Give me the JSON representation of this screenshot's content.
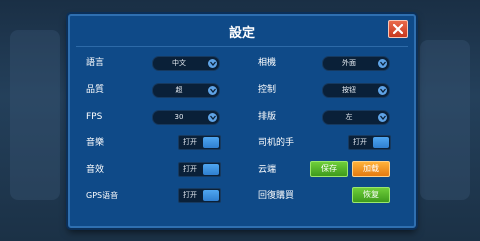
{
  "dialog": {
    "title": "設定",
    "close_icon": "close-icon"
  },
  "left": {
    "language": {
      "label": "語言",
      "value": "中文"
    },
    "quality": {
      "label": "品質",
      "value": "超"
    },
    "fps": {
      "label": "FPS",
      "value": "30"
    },
    "music": {
      "label": "音樂",
      "toggle_label": "打开"
    },
    "sound": {
      "label": "音效",
      "toggle_label": "打开"
    },
    "gps_voice": {
      "label": "GPS语音",
      "toggle_label": "打开"
    }
  },
  "right": {
    "camera": {
      "label": "相機",
      "value": "外面"
    },
    "control": {
      "label": "控制",
      "value": "按钮"
    },
    "layout": {
      "label": "排版",
      "value": "左"
    },
    "driver_hand": {
      "label": "司机的手",
      "toggle_label": "打开"
    },
    "cloud": {
      "label": "云端",
      "save_label": "保存",
      "load_label": "加载"
    },
    "restore_purchase": {
      "label": "回復購買",
      "button_label": "恢复"
    }
  },
  "colors": {
    "panel": "#0f4a88",
    "save_button": "#4caf2a",
    "load_button": "#f08c1a",
    "close_button": "#d84a2a"
  }
}
